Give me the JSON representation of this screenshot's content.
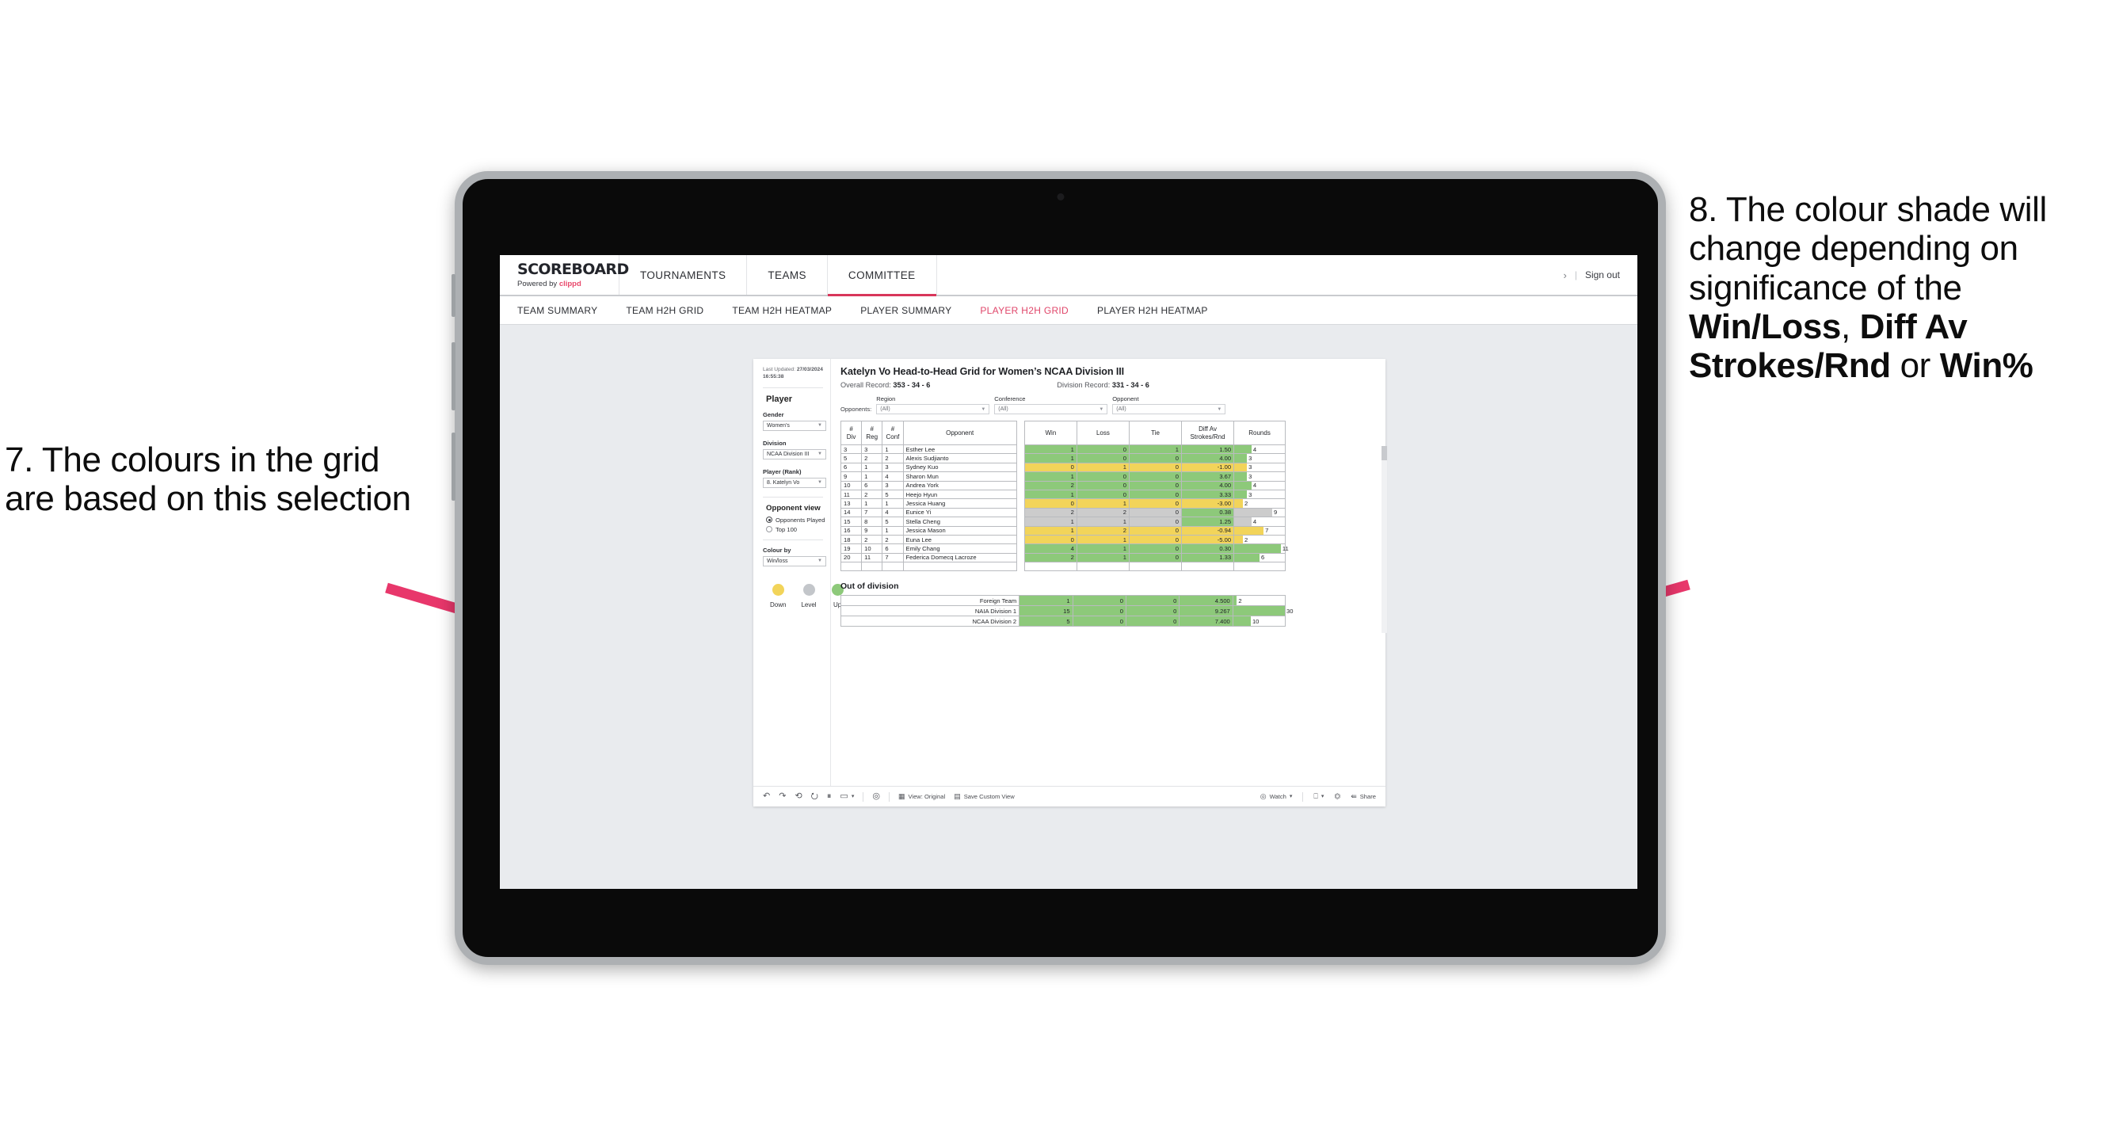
{
  "annotations": {
    "left": {
      "name": "annotation-7",
      "text": "7. The colours in the grid are based on this selection"
    },
    "right": {
      "name": "annotation-8",
      "prefix": "8. The colour shade will change depending on significance of the ",
      "bold1": "Win/Loss",
      "mid1": ", ",
      "bold2": "Diff Av Strokes/Rnd",
      "mid2": " or ",
      "bold3": "Win%"
    },
    "arrow_color": "#e8376b"
  },
  "app": {
    "brand": {
      "title": "SCOREBOARD",
      "powered_by": "Powered by ",
      "clippd": "clippd"
    },
    "topnav": [
      {
        "label": "TOURNAMENTS",
        "active": false
      },
      {
        "label": "TEAMS",
        "active": false
      },
      {
        "label": "COMMITTEE",
        "active": true
      }
    ],
    "topnav_right": {
      "chevron": "›",
      "separator": "|",
      "sign_out": "Sign out"
    },
    "subnav": [
      {
        "label": "TEAM SUMMARY",
        "active": false
      },
      {
        "label": "TEAM H2H GRID",
        "active": false
      },
      {
        "label": "TEAM H2H HEATMAP",
        "active": false
      },
      {
        "label": "PLAYER SUMMARY",
        "active": false
      },
      {
        "label": "PLAYER H2H GRID",
        "active": true
      },
      {
        "label": "PLAYER H2H HEATMAP",
        "active": false
      }
    ],
    "accent_color": "#d8365a"
  },
  "sidebar": {
    "last_updated_label": "Last Updated: ",
    "last_updated_value": "27/03/2024 16:55:38",
    "player_heading": "Player",
    "fields": [
      {
        "label": "Gender",
        "value": "Women’s"
      },
      {
        "label": "Division",
        "value": "NCAA Division III"
      },
      {
        "label": "Player (Rank)",
        "value": "8. Katelyn Vo"
      }
    ],
    "opponent_view": {
      "heading": "Opponent view",
      "options": [
        {
          "label": "Opponents Played",
          "selected": true
        },
        {
          "label": "Top 100",
          "selected": false
        }
      ]
    },
    "colour_by": {
      "label": "Colour by",
      "value": "Win/loss"
    },
    "legend": [
      {
        "label": "Down",
        "color": "#f2d45a"
      },
      {
        "label": "Level",
        "color": "#c3c6ca"
      },
      {
        "label": "Up",
        "color": "#8dc97a"
      }
    ]
  },
  "viz": {
    "title": "Katelyn Vo Head-to-Head Grid for Women’s NCAA Division III",
    "overall_record_label": "Overall Record: ",
    "overall_record_value": "353 -  34 - 6",
    "division_record_label": "Division Record: ",
    "division_record_value": "331 -  34 - 6",
    "opponents_label": "Opponents:",
    "filters": [
      {
        "label": "Region",
        "value": "(All)"
      },
      {
        "label": "Conference",
        "value": "(All)"
      },
      {
        "label": "Opponent",
        "value": "(All)"
      }
    ]
  },
  "chart_data": {
    "type": "table",
    "title": "Katelyn Vo Head-to-Head Grid for Women’s NCAA Division III",
    "columns": [
      "# Div",
      "# Reg",
      "# Conf",
      "Opponent",
      "Win",
      "Loss",
      "Tie",
      "Diff Av Strokes/Rnd",
      "Rounds"
    ],
    "column_headers_multiline": [
      {
        "l1": "#",
        "l2": "Div"
      },
      {
        "l1": "#",
        "l2": "Reg"
      },
      {
        "l1": "#",
        "l2": "Conf"
      },
      {
        "l1": "Opponent",
        "l2": ""
      },
      {
        "l1": "Win",
        "l2": ""
      },
      {
        "l1": "Loss",
        "l2": ""
      },
      {
        "l1": "Tie",
        "l2": ""
      },
      {
        "l1": "Diff Av",
        "l2": "Strokes/Rnd"
      },
      {
        "l1": "Rounds",
        "l2": ""
      }
    ],
    "colors": {
      "up": "#8dc97a",
      "down": "#f2d45a",
      "level": "#cccccc",
      "none": "#ffffff"
    },
    "rows": [
      {
        "div": "3",
        "reg": "3",
        "conf": "1",
        "opponent": "Esther Lee",
        "win": "1",
        "loss": "0",
        "tie": "1",
        "diff": "1.50",
        "rounds": "4",
        "bar_pct": 34,
        "shade": "up"
      },
      {
        "div": "5",
        "reg": "2",
        "conf": "2",
        "opponent": "Alexis Sudjianto",
        "win": "1",
        "loss": "0",
        "tie": "0",
        "diff": "4.00",
        "rounds": "3",
        "bar_pct": 25,
        "shade": "up"
      },
      {
        "div": "6",
        "reg": "1",
        "conf": "3",
        "opponent": "Sydney Kuo",
        "win": "0",
        "loss": "1",
        "tie": "0",
        "diff": "-1.00",
        "rounds": "3",
        "bar_pct": 25,
        "shade": "down"
      },
      {
        "div": "9",
        "reg": "1",
        "conf": "4",
        "opponent": "Sharon Mun",
        "win": "1",
        "loss": "0",
        "tie": "0",
        "diff": "3.67",
        "rounds": "3",
        "bar_pct": 25,
        "shade": "up"
      },
      {
        "div": "10",
        "reg": "6",
        "conf": "3",
        "opponent": "Andrea York",
        "win": "2",
        "loss": "0",
        "tie": "0",
        "diff": "4.00",
        "rounds": "4",
        "bar_pct": 34,
        "shade": "up"
      },
      {
        "div": "11",
        "reg": "2",
        "conf": "5",
        "opponent": "Heejo Hyun",
        "win": "1",
        "loss": "0",
        "tie": "0",
        "diff": "3.33",
        "rounds": "3",
        "bar_pct": 25,
        "shade": "up"
      },
      {
        "div": "13",
        "reg": "1",
        "conf": "1",
        "opponent": "Jessica Huang",
        "win": "0",
        "loss": "1",
        "tie": "0",
        "diff": "-3.00",
        "rounds": "2",
        "bar_pct": 17,
        "shade": "down"
      },
      {
        "div": "14",
        "reg": "7",
        "conf": "4",
        "opponent": "Eunice Yi",
        "win": "2",
        "loss": "2",
        "tie": "0",
        "diff": "0.38",
        "rounds": "9",
        "bar_pct": 75,
        "shade": "level",
        "diff_shade": "up"
      },
      {
        "div": "15",
        "reg": "8",
        "conf": "5",
        "opponent": "Stella Cheng",
        "win": "1",
        "loss": "1",
        "tie": "0",
        "diff": "1.25",
        "rounds": "4",
        "bar_pct": 34,
        "shade": "level",
        "diff_shade": "up"
      },
      {
        "div": "16",
        "reg": "9",
        "conf": "1",
        "opponent": "Jessica Mason",
        "win": "1",
        "loss": "2",
        "tie": "0",
        "diff": "-0.94",
        "rounds": "7",
        "bar_pct": 58,
        "shade": "down"
      },
      {
        "div": "18",
        "reg": "2",
        "conf": "2",
        "opponent": "Euna Lee",
        "win": "0",
        "loss": "1",
        "tie": "0",
        "diff": "-5.00",
        "rounds": "2",
        "bar_pct": 17,
        "shade": "down"
      },
      {
        "div": "19",
        "reg": "10",
        "conf": "6",
        "opponent": "Emily Chang",
        "win": "4",
        "loss": "1",
        "tie": "0",
        "diff": "0.30",
        "rounds": "11",
        "bar_pct": 92,
        "shade": "up"
      },
      {
        "div": "20",
        "reg": "11",
        "conf": "7",
        "opponent": "Federica Domecq Lacroze",
        "win": "2",
        "loss": "1",
        "tie": "0",
        "diff": "1.33",
        "rounds": "6",
        "bar_pct": 50,
        "shade": "up"
      }
    ],
    "out_of_division": {
      "title": "Out of division",
      "rows": [
        {
          "name": "Foreign Team",
          "win": "1",
          "loss": "0",
          "tie": "0",
          "diff": "4.500",
          "rounds": "2",
          "bar_pct": 7,
          "shade": "up"
        },
        {
          "name": "NAIA Division 1",
          "win": "15",
          "loss": "0",
          "tie": "0",
          "diff": "9.267",
          "rounds": "30",
          "bar_pct": 100,
          "shade": "up"
        },
        {
          "name": "NCAA Division 2",
          "win": "5",
          "loss": "0",
          "tie": "0",
          "diff": "7.400",
          "rounds": "10",
          "bar_pct": 34,
          "shade": "up"
        }
      ]
    }
  },
  "toolbar": {
    "undo_icon": "↶",
    "redo_icon": "↷",
    "revert_icon": "⟲",
    "refresh_icon": "⭮",
    "pause_icon": "⏸",
    "shape_icon": "▭",
    "caret_icon": "▾",
    "alerts_icon": "◎",
    "view_original": "View: Original",
    "save_custom_view": "Save Custom View",
    "watch": "Watch",
    "download_icon": "⬇",
    "fullscreen_icon": "⛶",
    "share": "Share"
  }
}
